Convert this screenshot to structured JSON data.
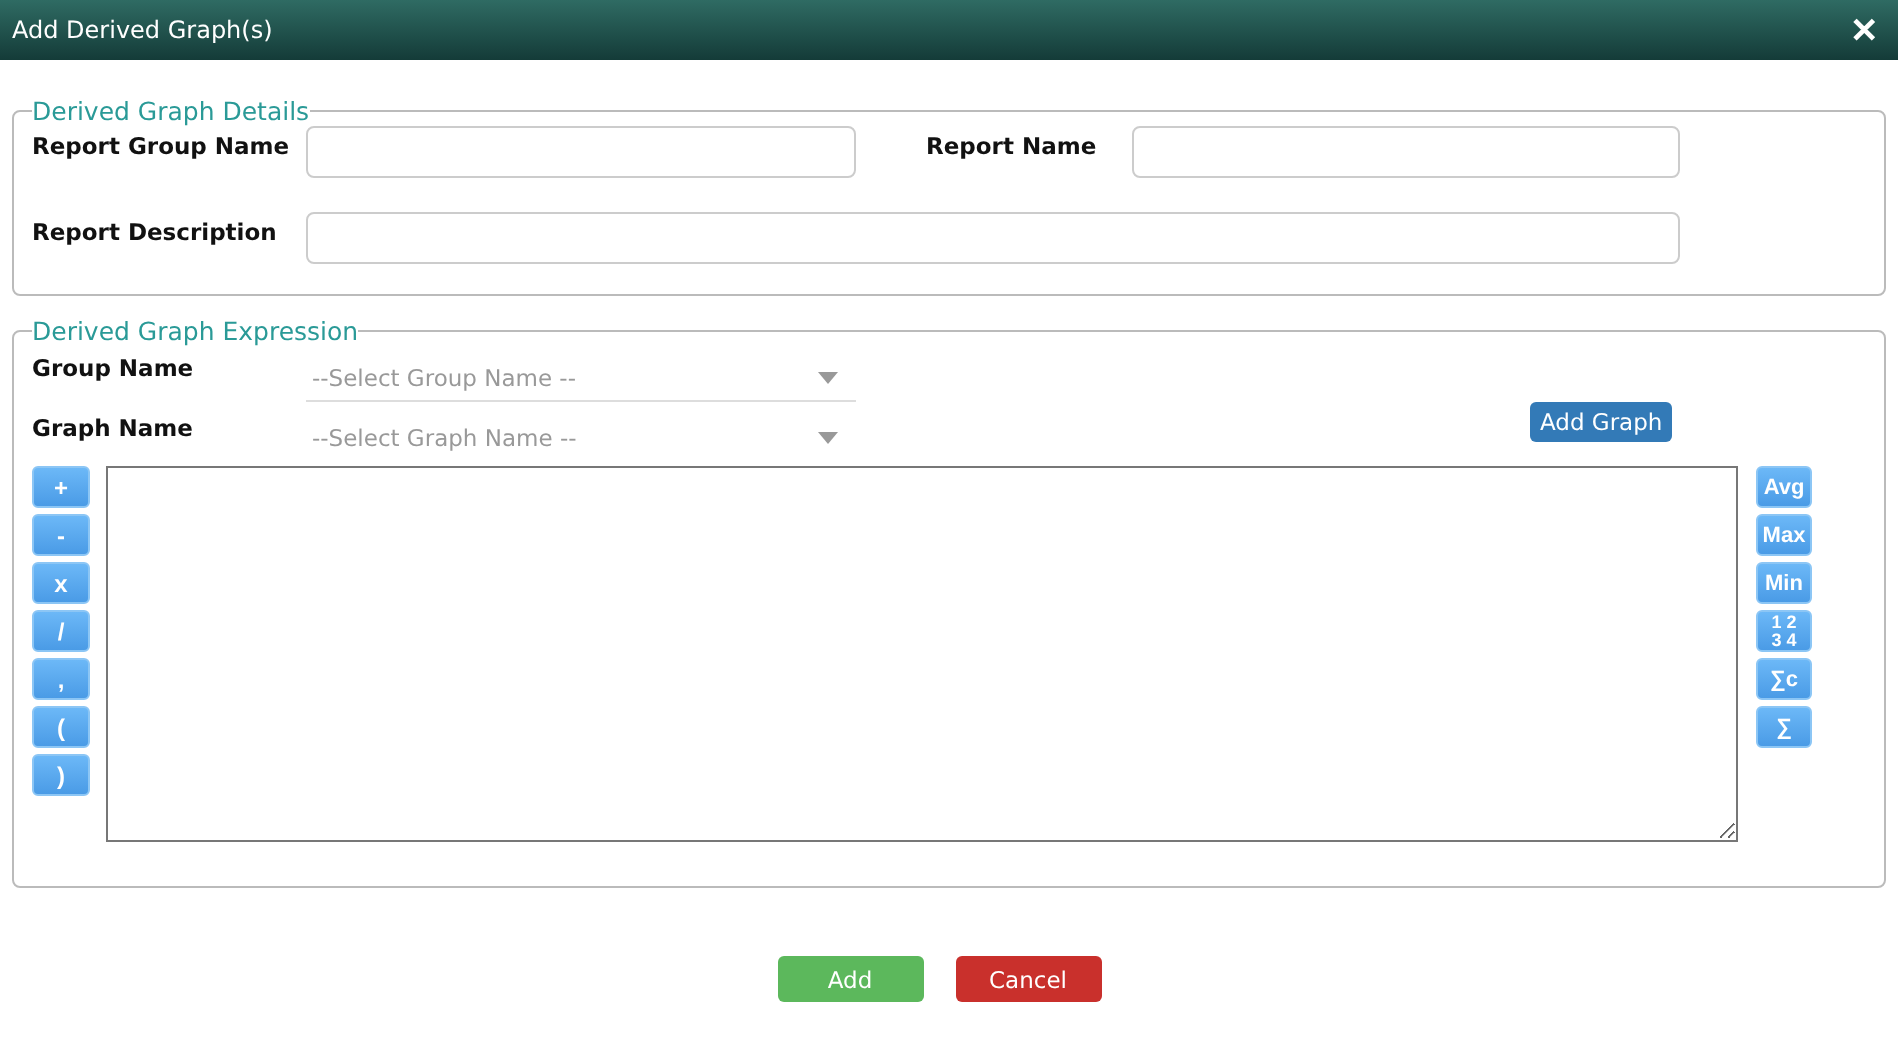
{
  "window": {
    "title": "Add Derived Graph(s)",
    "close": "✕"
  },
  "details": {
    "legend": "Derived Graph Details",
    "report_group_name": {
      "label": "Report Group Name"
    },
    "report_name": {
      "label": "Report Name"
    },
    "report_description": {
      "label": "Report Description"
    }
  },
  "expression": {
    "legend": "Derived Graph Expression",
    "group_name": {
      "label": "Group Name",
      "placeholder": "--Select Group Name --"
    },
    "graph_name": {
      "label": "Graph Name",
      "placeholder": "--Select Graph Name --"
    },
    "add_graph": "Add Graph",
    "operators": [
      "+",
      "-",
      "x",
      "/",
      ",",
      "(",
      ")"
    ],
    "functions": [
      {
        "kind": "text",
        "label": "Avg"
      },
      {
        "kind": "text",
        "label": "Max"
      },
      {
        "kind": "text",
        "label": "Min"
      },
      {
        "kind": "grid",
        "lines": [
          "1 2",
          "3 4"
        ]
      },
      {
        "kind": "text",
        "label": "∑c"
      },
      {
        "kind": "text",
        "label": "∑"
      }
    ]
  },
  "buttons": {
    "add": "Add",
    "cancel": "Cancel"
  }
}
